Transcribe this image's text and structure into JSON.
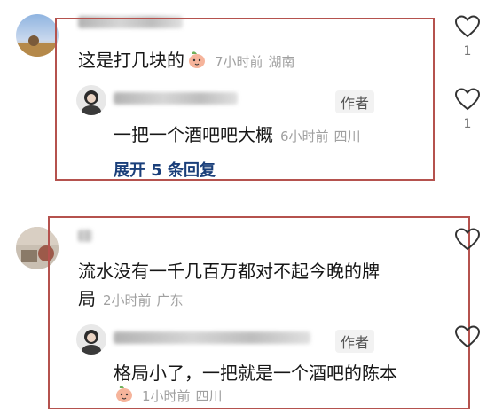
{
  "comments": [
    {
      "text": "这是打几块的",
      "time": "7小时前",
      "location": "湖南",
      "likes": "1",
      "reply": {
        "badge": "作者",
        "text": "一把一个酒吧吧大概",
        "time": "6小时前",
        "location": "四川",
        "likes": "1"
      },
      "expand_label": "展开 5 条回复"
    },
    {
      "text_line1": "流水没有一千几百万都对不起今晚的牌",
      "text_line2": "局",
      "time": "2小时前",
      "location": "广东",
      "reply": {
        "badge": "作者",
        "text": "格局小了，一把就是一个酒吧的陈本",
        "time": "1小时前",
        "location": "四川"
      }
    }
  ],
  "colors": {
    "frame": "#b5524e",
    "expand": "#1a3f7a",
    "meta": "#a0a0a0"
  },
  "icons": {
    "like": "heart-outline-icon",
    "emoji": "peach-emoji-icon"
  }
}
